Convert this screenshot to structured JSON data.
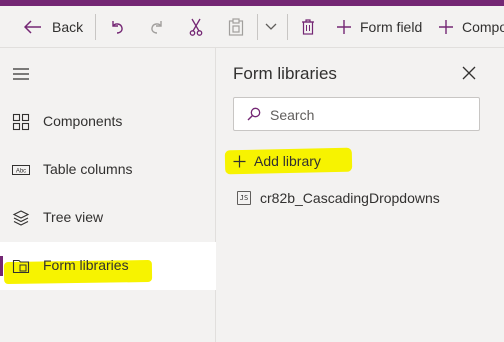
{
  "toolbar": {
    "back_label": "Back",
    "form_field_label": "Form field",
    "component_label": "Compo"
  },
  "nav": {
    "items": [
      {
        "label": "Components",
        "icon": "components-icon"
      },
      {
        "label": "Table columns",
        "icon": "table-columns-icon"
      },
      {
        "label": "Tree view",
        "icon": "tree-view-icon"
      },
      {
        "label": "Form libraries",
        "icon": "form-libraries-icon",
        "active": true
      }
    ]
  },
  "panel": {
    "title": "Form libraries",
    "search_placeholder": "Search",
    "add_library_label": "Add library",
    "libraries": [
      {
        "name": "cr82b_CascadingDropdowns",
        "icon_text": "JS"
      }
    ]
  },
  "colors": {
    "accent": "#742774",
    "highlight": "#f7f300",
    "background": "#f3f2f1"
  }
}
